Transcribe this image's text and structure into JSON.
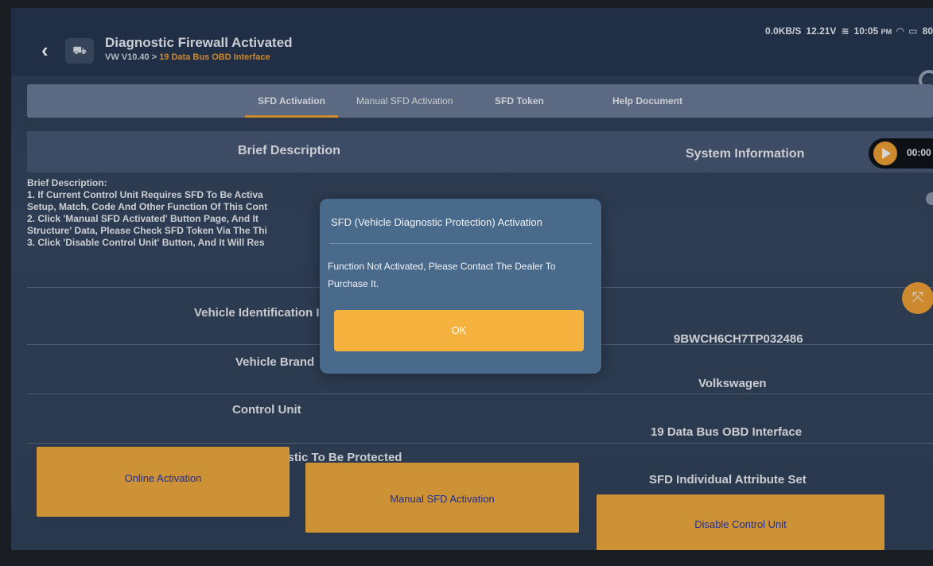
{
  "header": {
    "title": "Diagnostic Firewall Activated",
    "breadcrumb_1": "VW V10.40",
    "breadcrumb_sep": " > ",
    "breadcrumb_2": "19 Data Bus OBD Interface",
    "back_icon": "chevron-left-icon",
    "vehicle_icon": "car-icon"
  },
  "status_bar": {
    "network_speed": "0.0KB/S",
    "voltage": "12.21V",
    "time": "10:05",
    "ampm": "PM",
    "battery": "80"
  },
  "tabs": [
    {
      "label": "SFD Activation",
      "active": true
    },
    {
      "label": "Manual SFD Activation",
      "active": false
    },
    {
      "label": "SFD Token",
      "active": false
    },
    {
      "label": "Help Document",
      "active": false
    }
  ],
  "table": {
    "left_header": "Brief Description",
    "right_header": "System Information",
    "timer": "00:00",
    "description": [
      "Brief Description:",
      " 1. If Current Control Unit Requires SFD To Be Activa",
      "Setup, Match, Code And Other Function Of This Cont",
      " 2. Click 'Manual SFD Activated' Button Page, And It",
      "Structure' Data, Please Check SFD Token Via The Thi",
      " 3. Click 'Disable Control Unit' Button, And It Will Res"
    ],
    "rows": [
      {
        "label": "Vehicle Identification I",
        "value": "9BWCH6CH7TP032486"
      },
      {
        "label": "Vehicle Brand",
        "value": "Volkswagen"
      },
      {
        "label": "Control Unit",
        "value": "19 Data Bus OBD Interface"
      },
      {
        "label": "Status Of Vehicle Diagnostic To Be Protected",
        "value": "SFD Individual Attribute Set"
      }
    ]
  },
  "buttons": {
    "online": "Online Activation",
    "manual": "Manual SFD Activation",
    "disable": "Disable Control Unit"
  },
  "dialog": {
    "title": "SFD (Vehicle Diagnostic Protection) Activation",
    "message": "Function Not Activated, Please Contact The Dealer To Purchase It.",
    "ok": "OK"
  },
  "colors": {
    "accent": "#f6a12f",
    "button_bg": "#f6ad3a",
    "button_text": "#2233aa",
    "dialog_bg": "#4a6a8c"
  }
}
